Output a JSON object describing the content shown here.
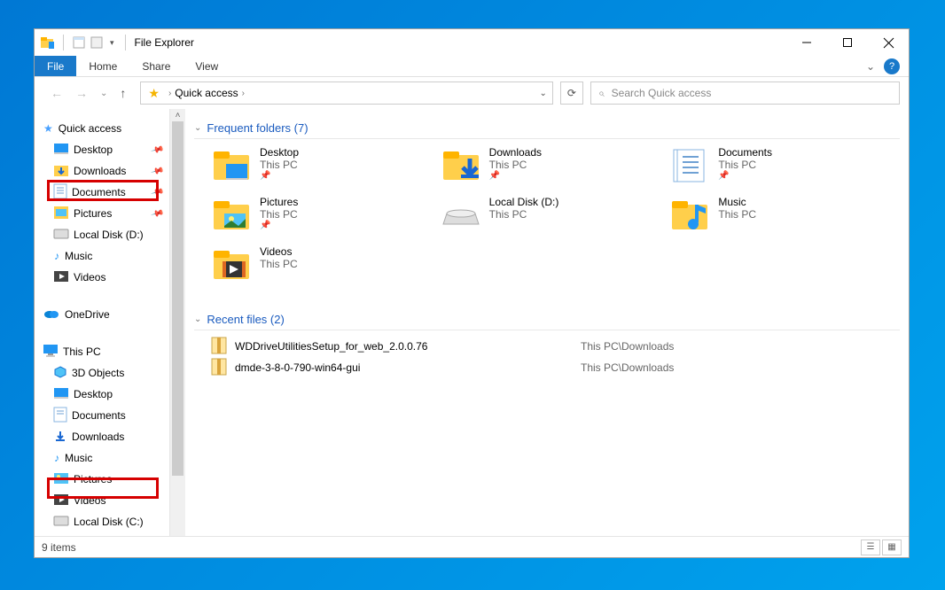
{
  "window": {
    "title": "File Explorer"
  },
  "ribbon": {
    "file": "File",
    "home": "Home",
    "share": "Share",
    "view": "View"
  },
  "crumb": {
    "location": "Quick access"
  },
  "search": {
    "placeholder": "Search Quick access"
  },
  "tree": {
    "quick_access": {
      "label": "Quick access"
    },
    "qa_items": [
      {
        "label": "Desktop"
      },
      {
        "label": "Downloads"
      },
      {
        "label": "Documents"
      },
      {
        "label": "Pictures"
      },
      {
        "label": "Local Disk (D:)"
      },
      {
        "label": "Music"
      },
      {
        "label": "Videos"
      }
    ],
    "onedrive": {
      "label": "OneDrive"
    },
    "thispc": {
      "label": "This PC"
    },
    "pc_items": [
      {
        "label": "3D Objects"
      },
      {
        "label": "Desktop"
      },
      {
        "label": "Documents"
      },
      {
        "label": "Downloads"
      },
      {
        "label": "Music"
      },
      {
        "label": "Pictures"
      },
      {
        "label": "Videos"
      },
      {
        "label": "Local Disk (C:)"
      }
    ]
  },
  "sections": {
    "frequent": "Frequent folders (7)",
    "recent": "Recent files (2)"
  },
  "folders": [
    {
      "name": "Desktop",
      "sub": "This PC",
      "pinned": true,
      "type": "desktop"
    },
    {
      "name": "Downloads",
      "sub": "This PC",
      "pinned": true,
      "type": "downloads"
    },
    {
      "name": "Documents",
      "sub": "This PC",
      "pinned": true,
      "type": "documents"
    },
    {
      "name": "Pictures",
      "sub": "This PC",
      "pinned": true,
      "type": "pictures"
    },
    {
      "name": "Local Disk (D:)",
      "sub": "This PC",
      "pinned": false,
      "type": "drive"
    },
    {
      "name": "Music",
      "sub": "This PC",
      "pinned": false,
      "type": "music"
    },
    {
      "name": "Videos",
      "sub": "This PC",
      "pinned": false,
      "type": "videos"
    }
  ],
  "files": [
    {
      "name": "WDDriveUtilitiesSetup_for_web_2.0.0.76",
      "path": "This PC\\Downloads"
    },
    {
      "name": "dmde-3-8-0-790-win64-gui",
      "path": "This PC\\Downloads"
    }
  ],
  "status": {
    "text": "9 items"
  }
}
